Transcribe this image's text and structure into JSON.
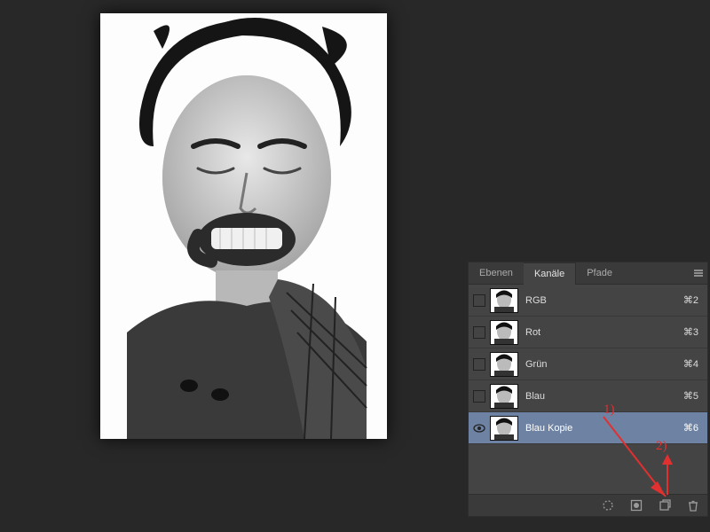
{
  "tabs": {
    "ebenen": "Ebenen",
    "kanaele": "Kanäle",
    "pfade": "Pfade"
  },
  "channels": [
    {
      "name": "RGB",
      "shortcut": "⌘2",
      "visible": false,
      "selected": false
    },
    {
      "name": "Rot",
      "shortcut": "⌘3",
      "visible": false,
      "selected": false
    },
    {
      "name": "Grün",
      "shortcut": "⌘4",
      "visible": false,
      "selected": false
    },
    {
      "name": "Blau",
      "shortcut": "⌘5",
      "visible": false,
      "selected": false
    },
    {
      "name": "Blau Kopie",
      "shortcut": "⌘6",
      "visible": true,
      "selected": true
    }
  ],
  "annotations": {
    "one": "1)",
    "two": "2)"
  },
  "colors": {
    "annotation": "#e03030",
    "panel_bg": "#444444",
    "selection_bg": "#6e83a3"
  }
}
